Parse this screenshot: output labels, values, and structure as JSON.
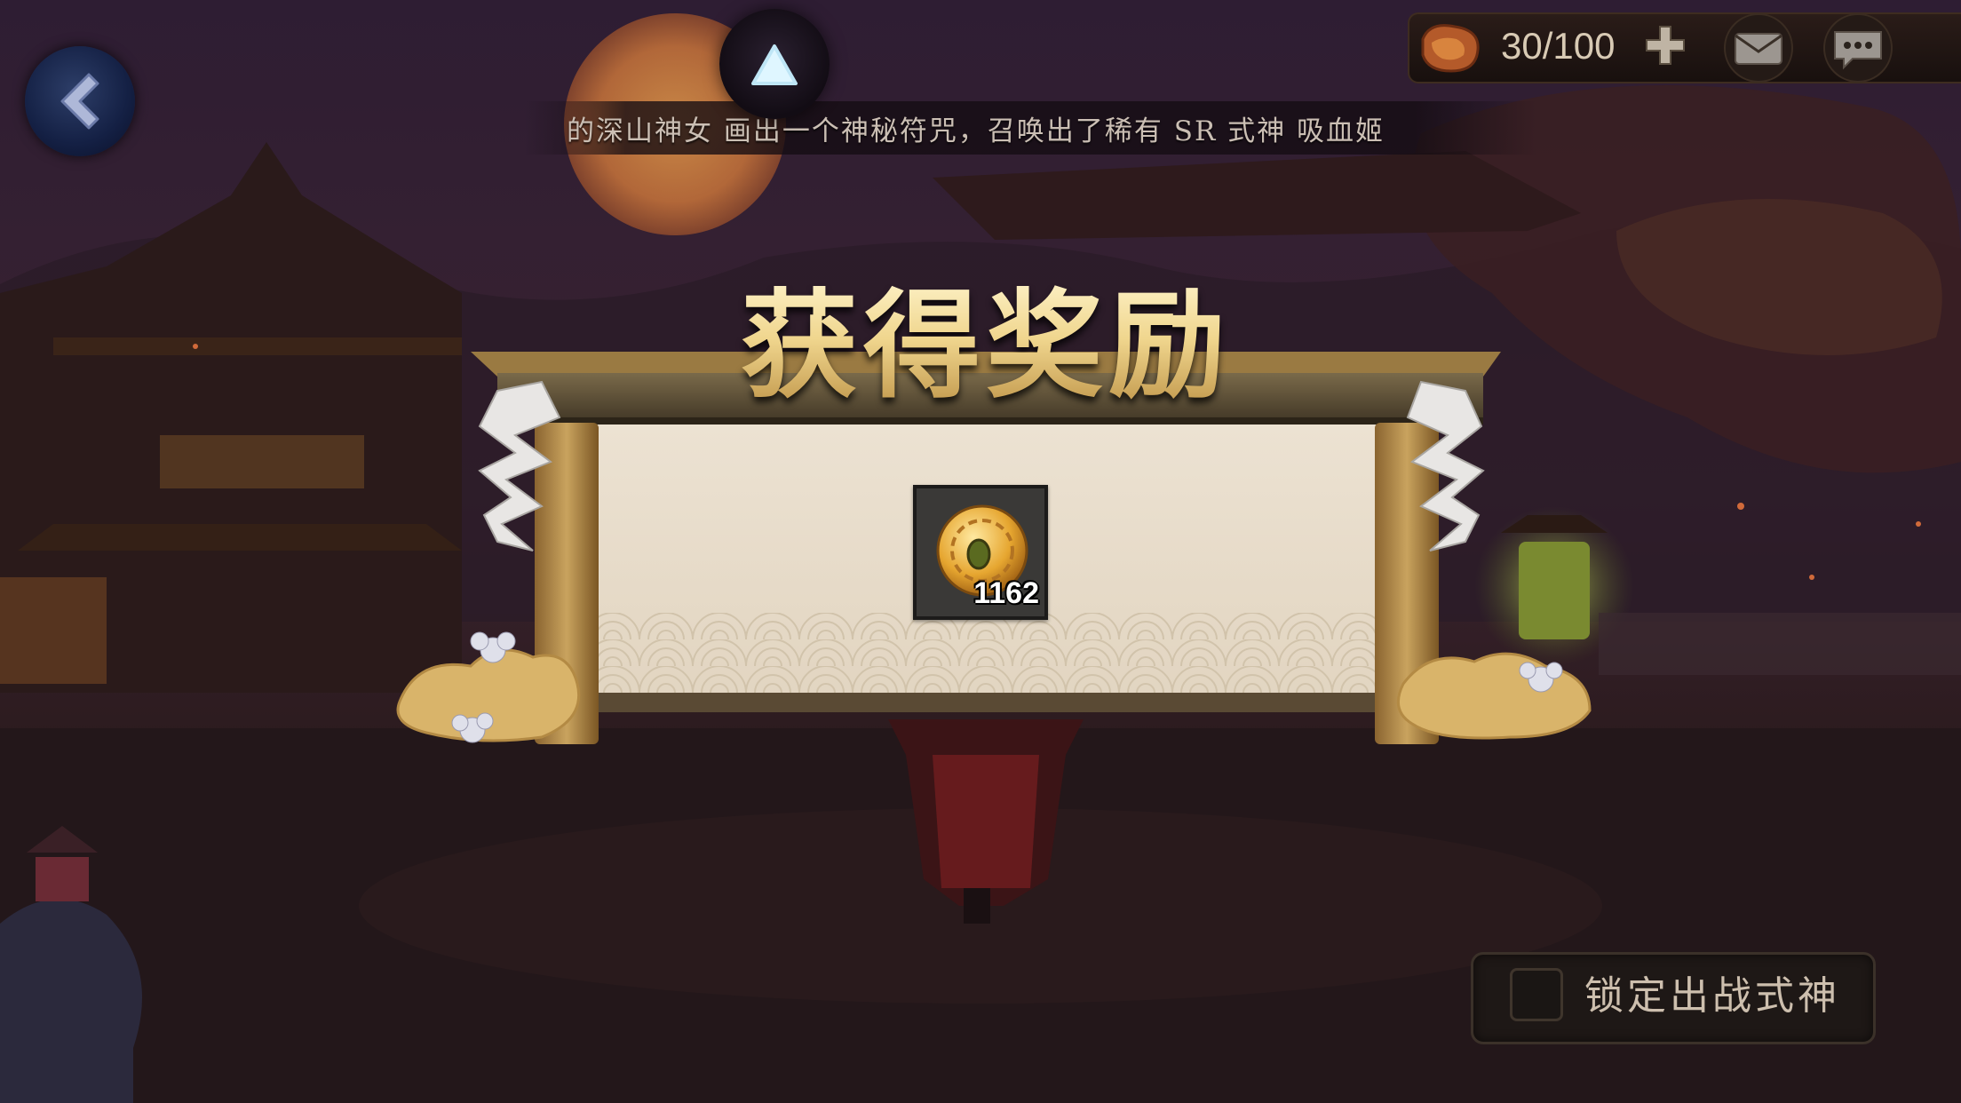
{
  "banner": {
    "message": "的深山神女 画出一个神秘符咒，召唤出了稀有 SR 式神 吸血姬"
  },
  "top_bar": {
    "resource": {
      "icon": "talisman-icon",
      "count": "30/100"
    },
    "buttons": [
      "plus-icon",
      "mail-icon",
      "chat-icon"
    ]
  },
  "reward_popup": {
    "title": "获得奖励",
    "items": [
      {
        "icon": "gold-coin-icon",
        "count": "1162"
      }
    ]
  },
  "lock_toggle": {
    "label": "锁定出战式神",
    "checked": false
  },
  "colors": {
    "accent_gold": "#e8c878",
    "night_sky": "#2b1a2e",
    "moon": "#d9883e"
  }
}
